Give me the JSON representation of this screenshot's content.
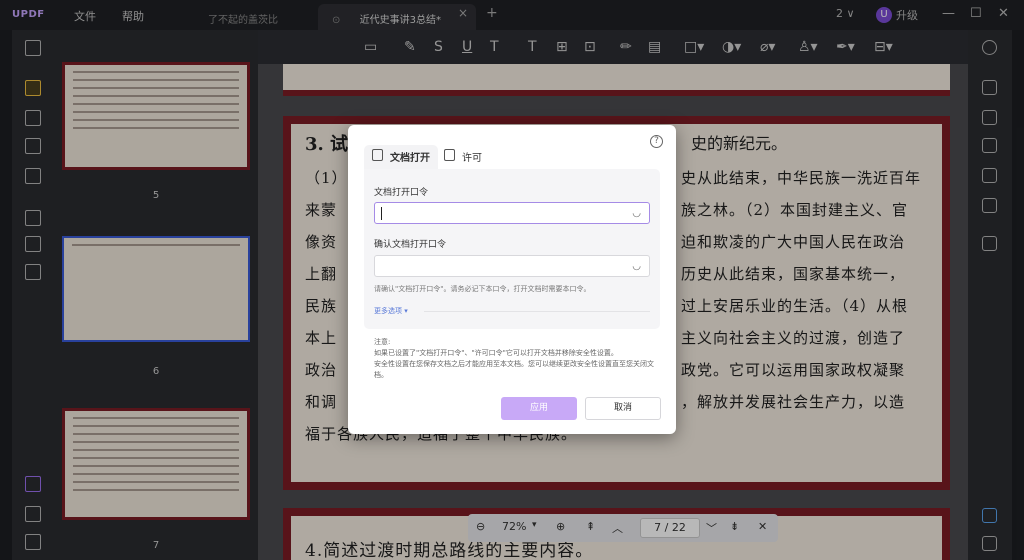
{
  "titlebar": {
    "logo": "UPDF",
    "menu": [
      "文件",
      "帮助"
    ],
    "tabs": [
      "了不起的盖茨比",
      "近代史事讲3总结*"
    ],
    "new_tab": "+",
    "close": "×",
    "window_count": "2 ∨",
    "avatar_letter": "U",
    "upgrade": "升级",
    "win_controls": [
      "—",
      "☐",
      "✕"
    ]
  },
  "thumbnails": {
    "page_numbers": [
      "5",
      "6",
      "7"
    ]
  },
  "document": {
    "page_main_heading": "3. 试",
    "page_main_heading_end": "史的新纪元。",
    "lines": [
      "（1）",
      "来蒙",
      "像资",
      "上翻",
      "民族",
      "本上",
      "政治",
      "和调",
      "福于各族人民，造福于整个中华民族。"
    ],
    "lines_right": [
      "史从此结束，中华民族一洗近百年",
      "族之林。（2）本国封建主义、官",
      "迫和欺凌的广大中国人民在政治",
      "历史从此结束，国家基本统一，",
      "过上安居乐业的生活。（4）从根",
      "主义向社会主义的过渡，创造了",
      "政党。它可以运用国家政权凝聚",
      "，解放并发展社会生产力，以造",
      ""
    ],
    "next_page_heading": "4.简述过渡时期总路线的主要内容。"
  },
  "pagenav": {
    "zoom": "72%",
    "current_page": "7",
    "separator": "/",
    "total_pages": "22"
  },
  "dialog": {
    "tabs": [
      "文档打开",
      "许可"
    ],
    "help": "?",
    "open_password_label": "文档打开口令",
    "confirm_password_label": "确认文档打开口令",
    "hint": "请确认\"文档打开口令\"。请务必记下本口令，打开文档时需要本口令。",
    "more_options": "更多选项",
    "note_title": "注意:",
    "note_line1": "如果已设置了\"文档打开口令\"、\"许可口令\"它可以打开文档并移除安全性设置。",
    "note_line2": "安全性设置在您保存文档之后才能应用至本文档。您可以继续更改安全性设置直至您关闭文档。",
    "apply": "应用",
    "cancel": "取消"
  }
}
